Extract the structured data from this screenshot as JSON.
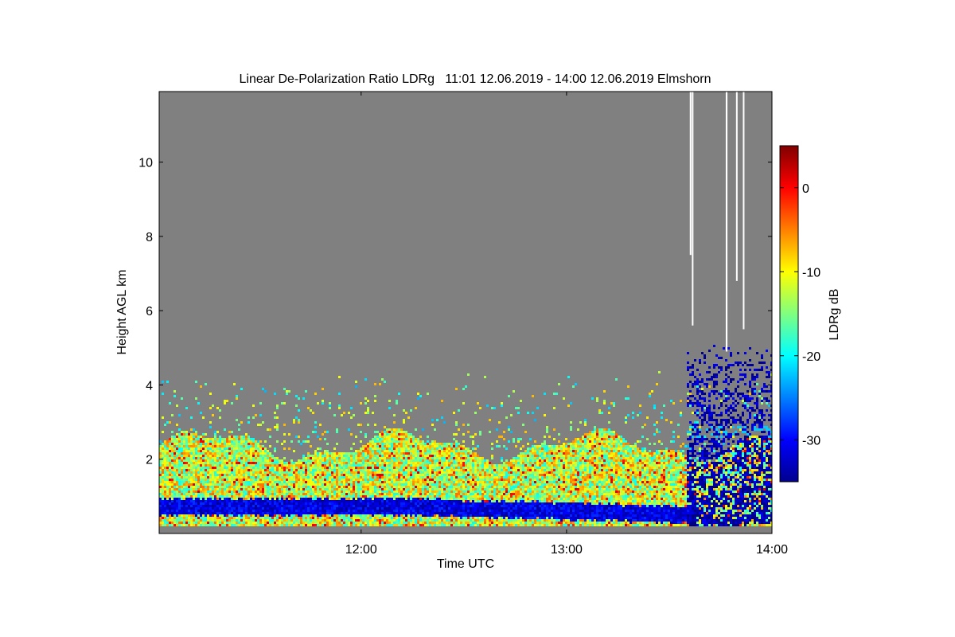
{
  "chart_data": {
    "type": "heatmap",
    "title": "Linear De-Polarization Ratio LDRg   11:01 12.06.2019 - 14:00 12.06.2019 Elmshorn",
    "xlabel": "Time UTC",
    "ylabel": "Height AGL km",
    "colorbar_label": "LDRg dB",
    "x_range": [
      "11:01",
      "14:00"
    ],
    "x_ticks": [
      "12:00",
      "13:00",
      "14:00"
    ],
    "y_range": [
      0,
      11.9
    ],
    "y_ticks": [
      2,
      4,
      6,
      8,
      10
    ],
    "color_range": [
      -35,
      5
    ],
    "colorbar_ticks": [
      0,
      -10,
      -20,
      -30
    ],
    "colormap": "jet",
    "missing_value_color": "#808080",
    "grid": false,
    "features": [
      {
        "kind": "boundary_layer",
        "time": [
          "11:01",
          "14:00"
        ],
        "height_km": [
          0.2,
          2.6
        ],
        "ldr_db": -12
      },
      {
        "kind": "low_ldr_band",
        "time": [
          "11:01",
          "13:37"
        ],
        "height_km": [
          0.4,
          0.9
        ],
        "ldr_db": -31
      },
      {
        "kind": "sparse_returns",
        "time": [
          "11:01",
          "14:00"
        ],
        "height_km": [
          2.6,
          4.5
        ],
        "ldr_db": -15
      },
      {
        "kind": "cloud",
        "time": [
          "13:35",
          "14:00"
        ],
        "height_km": [
          0.1,
          5.2
        ],
        "ldr_db": -33
      },
      {
        "kind": "no_data",
        "time": [
          "13:36",
          "13:52"
        ],
        "height_km": [
          4.5,
          11.9
        ]
      }
    ]
  }
}
